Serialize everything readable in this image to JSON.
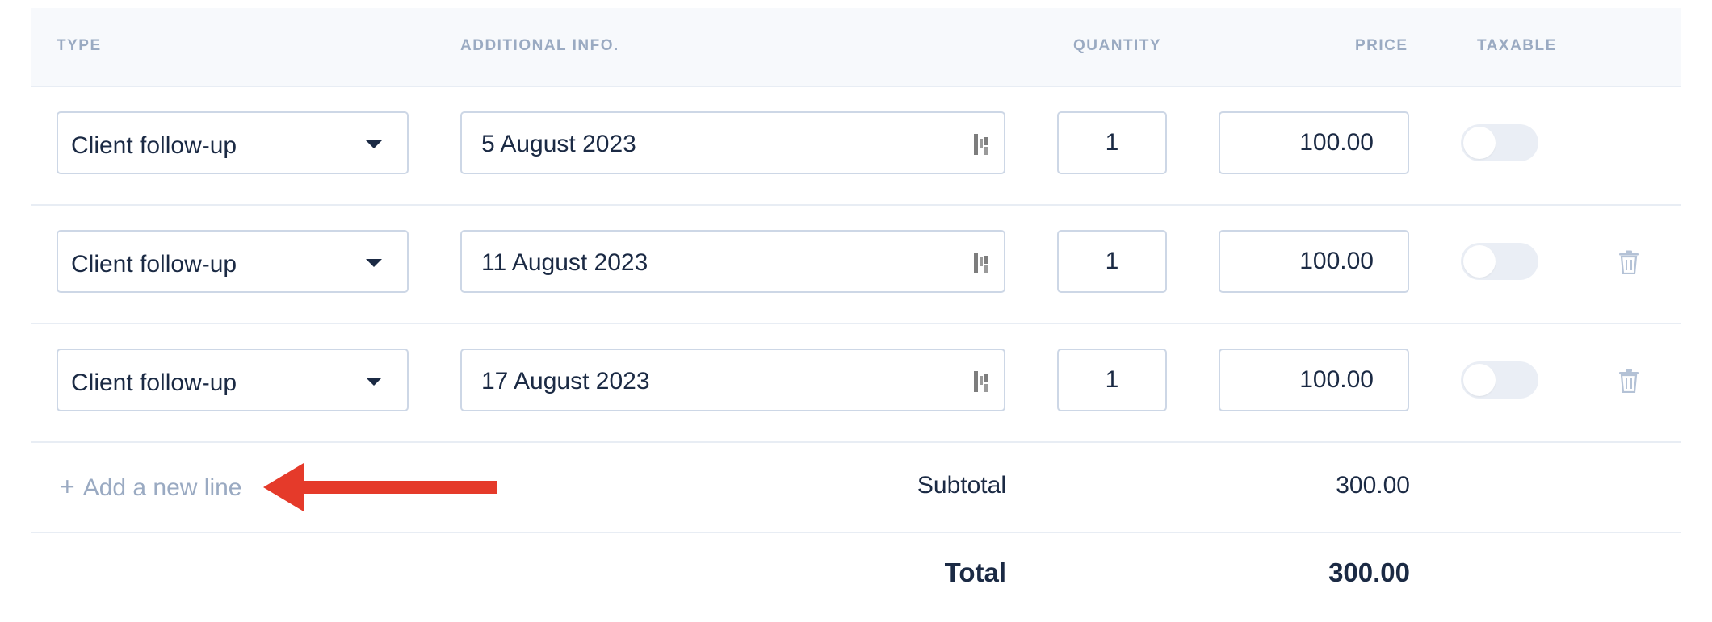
{
  "table": {
    "headers": {
      "type": "TYPE",
      "info": "ADDITIONAL INFO.",
      "quantity": "QUANTITY",
      "price": "PRICE",
      "taxable": "TAXABLE"
    },
    "rows": [
      {
        "type": "Client follow-up",
        "info": "5 August 2023",
        "quantity": "1",
        "price": "100.00",
        "taxable": false,
        "deletable": false
      },
      {
        "type": "Client follow-up",
        "info": "11 August 2023",
        "quantity": "1",
        "price": "100.00",
        "taxable": false,
        "deletable": true
      },
      {
        "type": "Client follow-up",
        "info": "17 August 2023",
        "quantity": "1",
        "price": "100.00",
        "taxable": false,
        "deletable": true
      }
    ]
  },
  "footer": {
    "add_line_icon": "+",
    "add_line_label": "Add a new line",
    "subtotal_label": "Subtotal",
    "subtotal_value": "300.00",
    "total_label": "Total",
    "total_value": "300.00"
  },
  "annotation": {
    "type": "arrow",
    "direction": "left",
    "color": "#e53a2a"
  },
  "colors": {
    "text": "#1b2a44",
    "muted": "#9aaac2",
    "border": "#cdd7e6",
    "header_bg": "#f7f9fc",
    "accent_arrow": "#e53a2a"
  }
}
